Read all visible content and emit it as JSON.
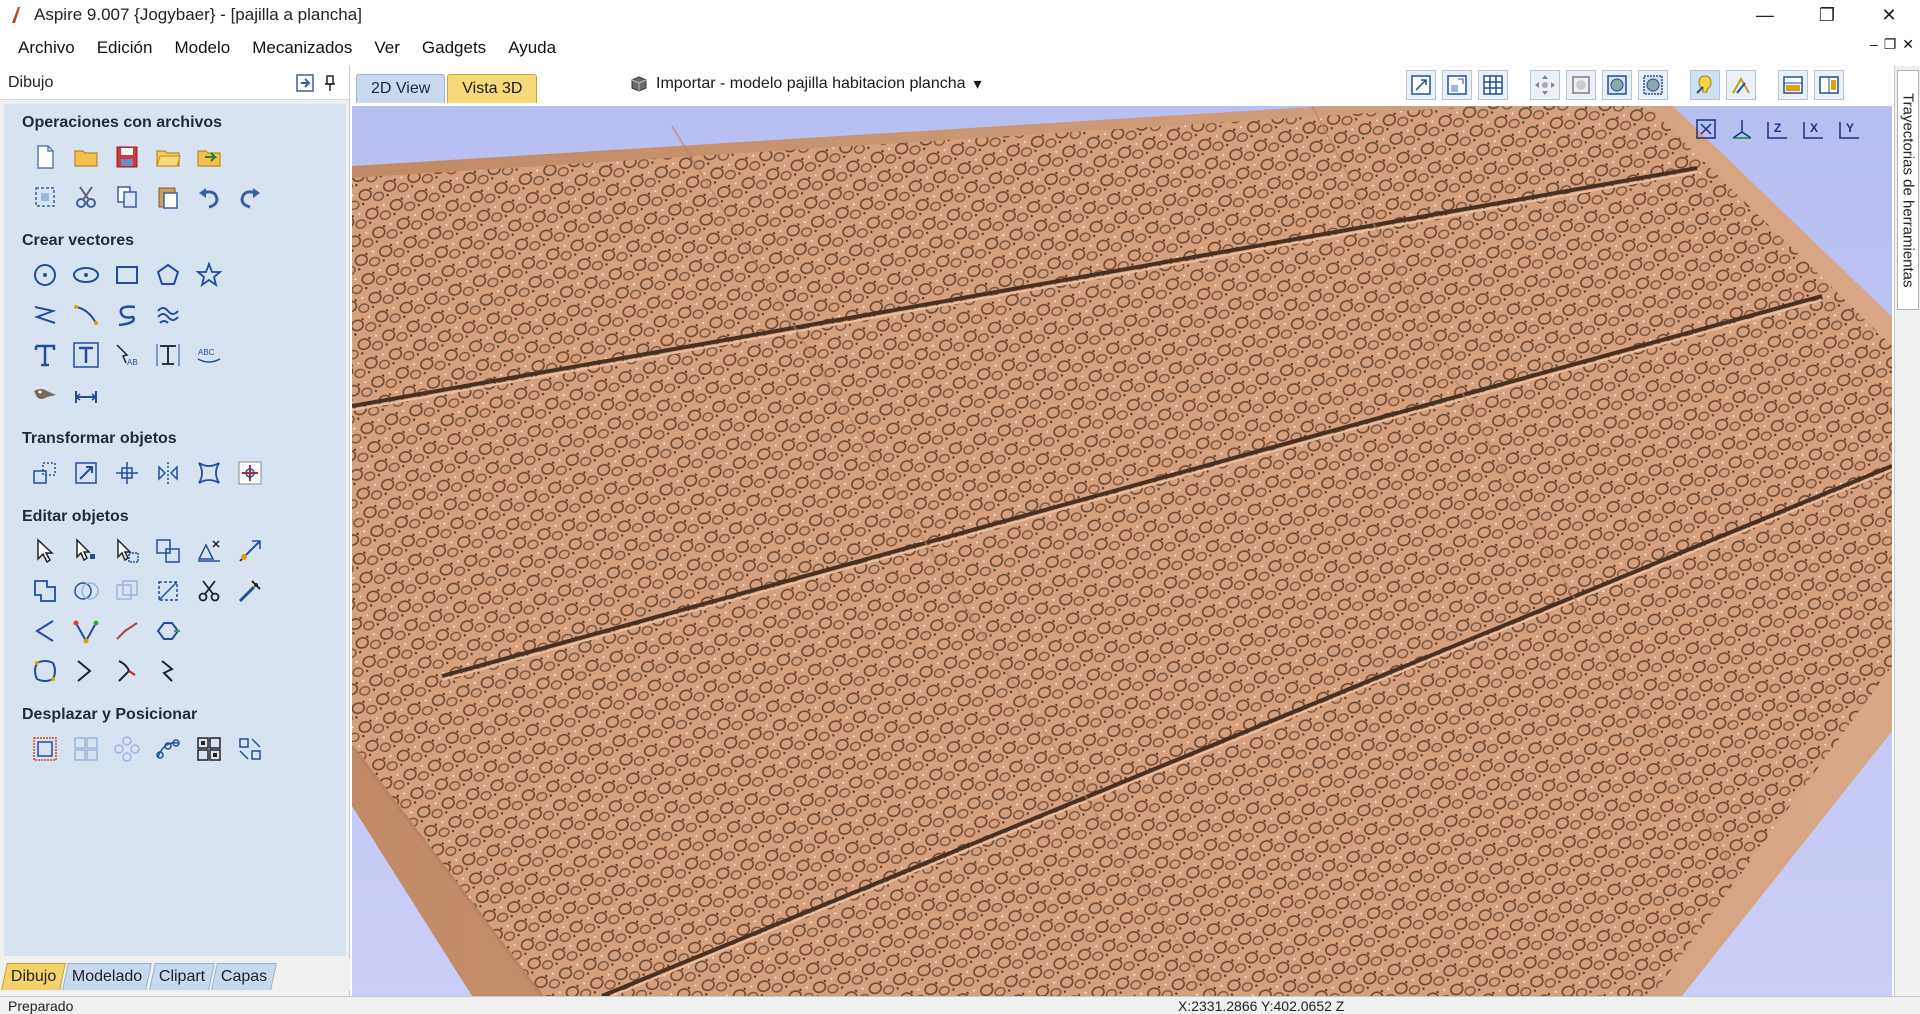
{
  "window": {
    "title": "Aspire 9.007 {Jogybaer} - [pajilla a plancha]",
    "minimize_glyph": "—",
    "maximize_glyph": "❐",
    "close_glyph": "✕"
  },
  "menu": {
    "items": [
      "Archivo",
      "Edición",
      "Modelo",
      "Mecanizados",
      "Ver",
      "Gadgets",
      "Ayuda"
    ],
    "mdi_minimize": "–",
    "mdi_restore": "❐",
    "mdi_close": "✕"
  },
  "left_panel": {
    "title": "Dibujo",
    "sections": [
      {
        "title": "Operaciones con archivos"
      },
      {
        "title": "Crear vectores"
      },
      {
        "title": "Transformar objetos"
      },
      {
        "title": "Editar objetos"
      },
      {
        "title": "Desplazar y Posicionar"
      }
    ],
    "bottom_tabs": [
      {
        "label": "Dibujo",
        "active": true
      },
      {
        "label": "Modelado",
        "active": false
      },
      {
        "label": "Clipart",
        "active": false
      },
      {
        "label": "Capas",
        "active": false
      }
    ],
    "icons": {
      "file_ops": [
        "new-file-icon",
        "open-folder-icon",
        "save-icon",
        "open-recent-icon",
        "import-icon",
        "select-all-icon",
        "cut-icon",
        "copy-icon",
        "paste-icon",
        "undo-icon",
        "redo-icon"
      ],
      "create_vectors": [
        "circle-icon",
        "ellipse-icon",
        "rectangle-icon",
        "polygon-icon",
        "star-icon",
        "polyline-icon",
        "line-icon",
        "curve-icon",
        "spiral-icon",
        "text-icon",
        "text-box-icon",
        "text-on-curve-icon",
        "auto-layout-text-icon",
        "arc-text-icon",
        "trace-bitmap-icon",
        "dimension-icon"
      ],
      "transform": [
        "move-icon",
        "scale-icon",
        "rotate-icon",
        "mirror-icon",
        "distort-icon",
        "align-center-icon"
      ],
      "edit": [
        "select-icon",
        "node-edit-icon",
        "transform-select-icon",
        "group-icon",
        "ungroup-icon",
        "measure-icon",
        "weld-icon",
        "subtract-icon",
        "intersect-icon",
        "offset-icon",
        "trim-icon",
        "fillet-icon",
        "smooth-icon",
        "node-icon",
        "curve-fit-icon",
        "join-icon",
        "close-vector-icon",
        "extend-icon",
        "break-icon",
        "slice-icon"
      ],
      "position": [
        "array-icon",
        "grid-array-icon",
        "circular-array-icon",
        "path-copy-icon",
        "nesting-icon",
        "offset-copy-icon"
      ]
    }
  },
  "view_tabs": [
    {
      "label": "2D View",
      "active": false
    },
    {
      "label": "Vista 3D",
      "active": true
    }
  ],
  "import_label": "Importar - modelo pajilla habitacion plancha",
  "view_toolbar_icons": [
    "zoom-extents-icon",
    "zoom-box-icon",
    "grid-icon",
    "pan-icon",
    "zoom-in-icon",
    "zoom-out-icon",
    "zoom-selected-icon",
    "lighting-icon",
    "shading-icon",
    "split-view-icon",
    "toolpath-view-icon"
  ],
  "axis_icons": [
    {
      "name": "fit-view-icon",
      "label": ""
    },
    {
      "name": "iso-view-icon",
      "label": ""
    },
    {
      "name": "top-view-icon",
      "label": "Z"
    },
    {
      "name": "front-view-icon",
      "label": "X"
    },
    {
      "name": "side-view-icon",
      "label": "Y"
    }
  ],
  "right_panel": {
    "tab_label": "Trayectorias de herramientas"
  },
  "status": {
    "left": "Preparado",
    "coords": "X:2331.2866 Y:402.0652 Z"
  },
  "colors": {
    "panel_bg": "#d8e3f1",
    "viewport_bg": "#c0c6f3",
    "wood": "#d6a07c",
    "active_tab": "#f7d978"
  }
}
